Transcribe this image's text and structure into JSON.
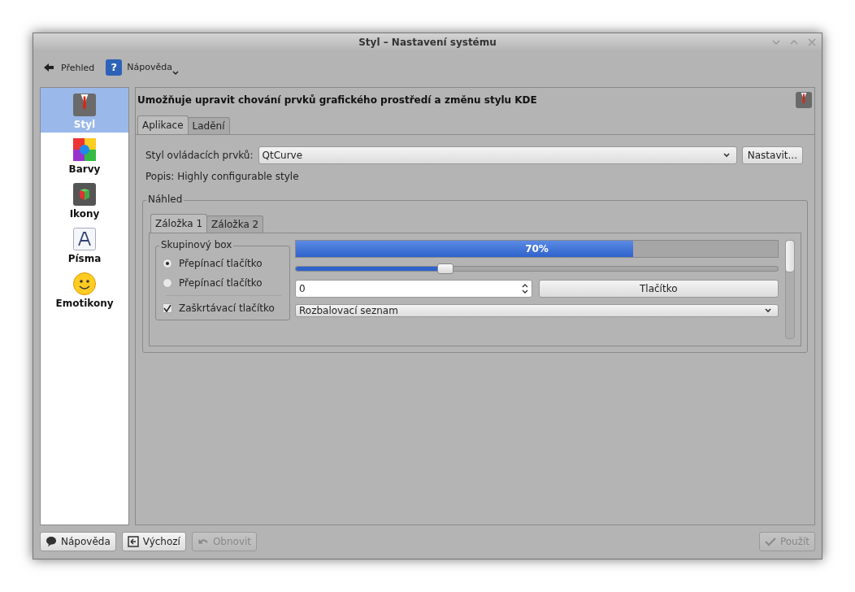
{
  "window": {
    "title": "Styl – Nastavení systému"
  },
  "toolbar": [
    {
      "kind": "back",
      "label": "Přehled"
    },
    {
      "kind": "help",
      "icon": "?",
      "label": "Nápověda"
    }
  ],
  "sidebar": {
    "items": [
      {
        "kind": "style",
        "label": "Styl",
        "selected": true
      },
      {
        "kind": "colors",
        "label": "Barvy",
        "selected": false
      },
      {
        "kind": "icons",
        "label": "Ikony",
        "selected": false
      },
      {
        "kind": "fonts",
        "label": "Písma",
        "selected": false
      },
      {
        "kind": "emoticons",
        "label": "Emotikony",
        "selected": false
      }
    ]
  },
  "header": {
    "description": "Umožňuje upravit chování prvků grafického prostředí a změnu stylu KDE"
  },
  "tabs": [
    {
      "label": "Aplikace",
      "selected": true
    },
    {
      "label": "Ladění",
      "selected": false
    }
  ],
  "widget_style": {
    "label": "Styl ovládacích prvků:",
    "value": "QtCurve",
    "button": "Nastavit..."
  },
  "description": "Popis: Highly configurable style",
  "preview": {
    "title": "Náhled",
    "tabs": [
      {
        "label": "Záložka 1",
        "selected": true
      },
      {
        "label": "Záložka 2",
        "selected": false
      }
    ],
    "group": {
      "title": "Skupinový box",
      "radios": [
        {
          "label": "Přepínací tlačítko",
          "selected": true
        },
        {
          "label": "Přepínací tlačítko",
          "selected": false
        }
      ],
      "checkbox": {
        "label": "Zaškrtávací tlačítko",
        "checked": true
      }
    },
    "progress": {
      "level": 0.7,
      "text": "70%"
    },
    "slider": {
      "level": 0.31
    },
    "spinbox": {
      "value": "0"
    },
    "button": "Tlačítko",
    "combo": "Rozbalovací seznam"
  },
  "buttons": [
    {
      "kind": "help",
      "label": "Nápověda",
      "disabled": false
    },
    {
      "kind": "defaults",
      "label": "Výchozí",
      "disabled": false
    },
    {
      "kind": "reset",
      "label": "Obnovit",
      "disabled": true
    },
    {
      "kind": "apply",
      "label": "Použít",
      "disabled": true
    }
  ]
}
